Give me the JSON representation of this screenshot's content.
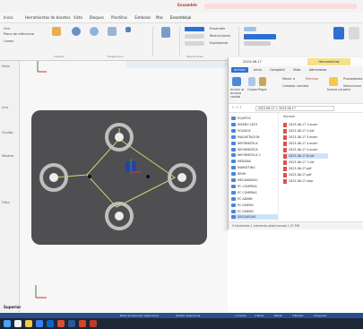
{
  "title_bar": {
    "context_tab": "Ensamble"
  },
  "ribbon_tabs": [
    "Inicio",
    "Herramientas de bocetos",
    "Vista",
    "Bloques",
    "Plantillas",
    "Simbolos",
    "Mas",
    "Ensamblaje"
  ],
  "ribbon": {
    "groups": [
      "Insertar",
      "Preparacion",
      "Operaciones"
    ],
    "left_labels": [
      "Unir",
      "Plano de referencia",
      "Lineas"
    ],
    "right_labels": [
      "Ensamble",
      "Restricciones",
      "Explosionar"
    ]
  },
  "left_panel": {
    "labels": [
      "Vista",
      "Unir",
      "Ocultar",
      "Mostrar",
      "Filtro"
    ]
  },
  "explorer": {
    "title": "2023-06-17",
    "context_tab": "Herramientas",
    "tabs": [
      "Archivo",
      "Inicio",
      "Compartir",
      "Vista",
      "Administrar"
    ],
    "ribbon_labels": [
      "Anclar al acceso rapido",
      "Copiar",
      "Pegar",
      "Mover a",
      "Eliminar",
      "Cambiar nombre",
      "Nueva carpeta",
      "Propiedades",
      "Seleccionar"
    ],
    "address": "2023-06-17 > 2023-06-17",
    "nav_items": [
      "EQUIPOS",
      "DISENO 2023",
      "SOLIDOS",
      "MAQUETACION",
      "INFORMATICA",
      "INFORMATICA",
      "INFORMATICA 2",
      "MEDIDAS",
      "MARKETING",
      "RRHH",
      "MECANIZADO",
      "PC COMPRAS",
      "PC COMPRAS",
      "PC ADMIN",
      "PC DISENO",
      "PC DISENO",
      "DESCARGAS"
    ],
    "files_header": "Nombre",
    "files": [
      "2023-06-17 1.ecam",
      "2023-06-17 2.dxf",
      "2023-06-17 3.ecam",
      "2023-06-17 4.ecam",
      "2023-06-17 5.ecam",
      "2023-06-17 6.dxf",
      "2023-06-17 7.dxf",
      "2023-06-17.pdf",
      "2023-06-17.pdf",
      "2023-06-17.step"
    ],
    "status": "9 elementos   1 elemento seleccionado  1,37 MB"
  },
  "bottom_label": "Superior",
  "status_bar": {
    "left": "Nivel de seleccion: seleccionar",
    "middle": "Grados: seleccionar",
    "right_items": [
      "1 Cuadro",
      "2 Plano",
      "Planta",
      "3 Boceto",
      "4 Superior"
    ]
  },
  "taskbar": {
    "icon_names": [
      "windows-icon",
      "search-icon",
      "file-explorer-icon",
      "browser-icon",
      "mail-icon",
      "cad-icon",
      "word-icon",
      "powerpoint-icon",
      "acrobat-icon"
    ],
    "colors": [
      "#4aa3ff",
      "#f2f2f2",
      "#f2c94c",
      "#3b82f6",
      "#0a64c8",
      "#e04a3b",
      "#2b579a",
      "#d24726",
      "#c0392b"
    ]
  },
  "colors": {
    "part_plate": "#4f4f52",
    "hole_ring": "#bfbfbf",
    "sketch_line": "#d9d36a",
    "accent": "#2f6fd1",
    "status_bar": "#2a4f8f"
  }
}
